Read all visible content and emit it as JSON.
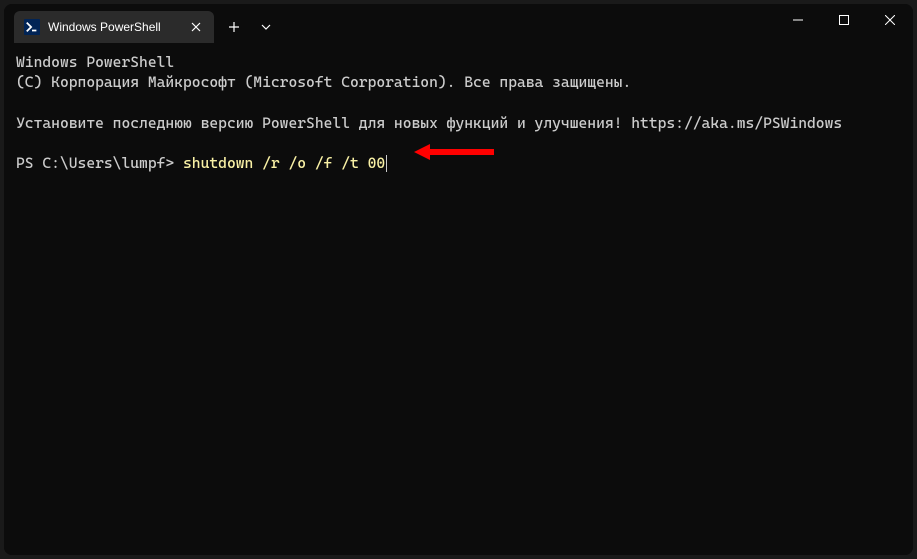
{
  "tab": {
    "title": "Windows PowerShell",
    "icon_label": ">_"
  },
  "terminal": {
    "line1": "Windows PowerShell",
    "line2": "(C) Корпорация Майкрософт (Microsoft Corporation). Все права защищены.",
    "line3": "Установите последнюю версию PowerShell для новых функций и улучшения! https://aka.ms/PSWindows",
    "prompt": "PS C:\\Users\\lumpf> ",
    "command": "shutdown /r /o /f /t 00"
  },
  "annotation": {
    "arrow_color": "#ff0000"
  }
}
